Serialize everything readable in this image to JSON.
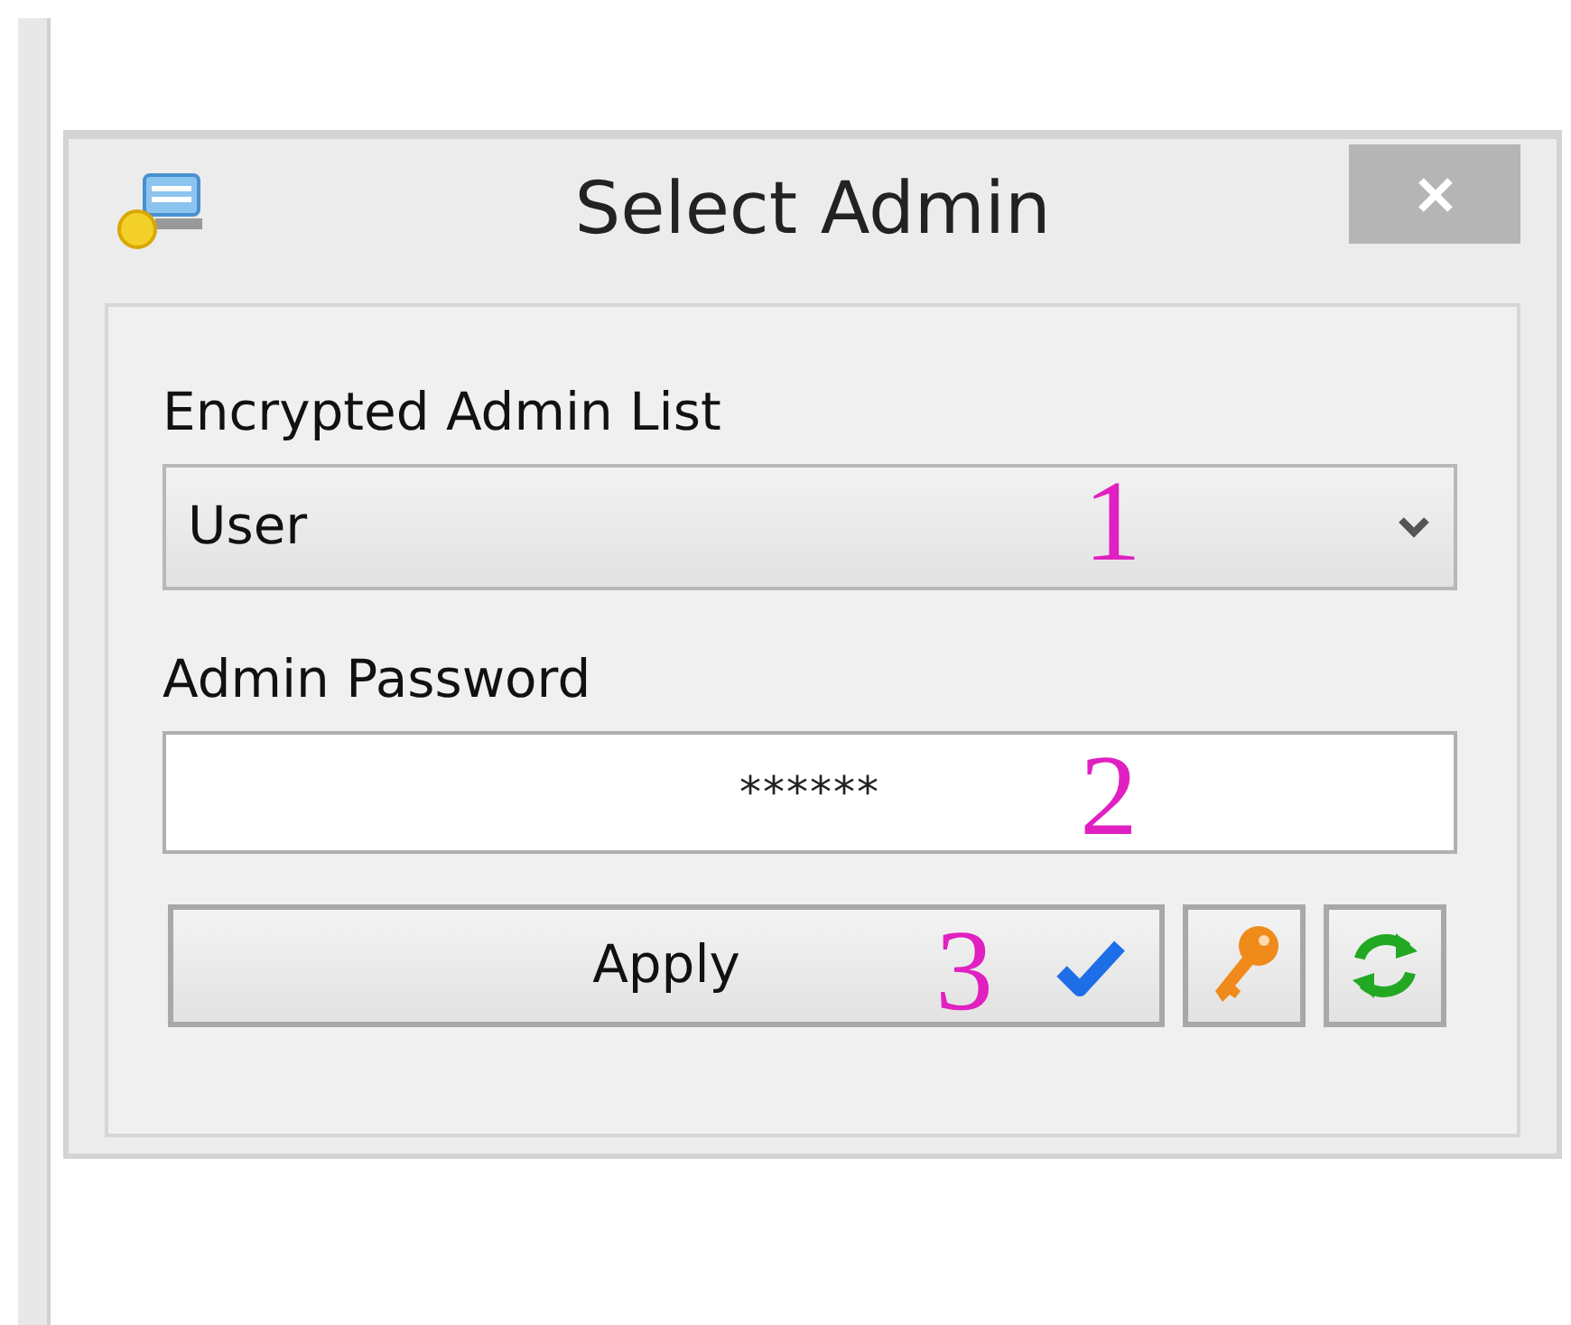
{
  "window": {
    "title": "Select Admin"
  },
  "fields": [
    {
      "kind": "dropdown",
      "label": "Encrypted Admin List",
      "value": "User",
      "annotation": "1"
    },
    {
      "kind": "password",
      "label": "Admin Password",
      "value": "******",
      "annotation": "2"
    }
  ],
  "buttons": [
    {
      "kind": "apply",
      "label": "Apply",
      "annotation": "3"
    },
    {
      "kind": "key"
    },
    {
      "kind": "refresh"
    }
  ]
}
